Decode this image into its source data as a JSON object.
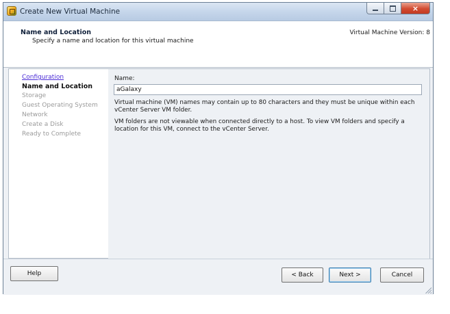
{
  "window": {
    "title": "Create New Virtual Machine",
    "icon": "vsphere-vm-icon",
    "controls": {
      "minimize": "minimize-icon",
      "maximize": "maximize-icon",
      "close": "×"
    }
  },
  "header": {
    "title": "Name and Location",
    "subtitle": "Specify a name and location for this virtual machine",
    "version": "Virtual Machine Version: 8"
  },
  "sidebar": {
    "items": [
      {
        "label": "Configuration",
        "state": "link"
      },
      {
        "label": "Name and Location",
        "state": "current"
      },
      {
        "label": "Storage",
        "state": "disabled"
      },
      {
        "label": "Guest Operating System",
        "state": "disabled"
      },
      {
        "label": "Network",
        "state": "disabled"
      },
      {
        "label": "Create a Disk",
        "state": "disabled"
      },
      {
        "label": "Ready to Complete",
        "state": "disabled"
      }
    ]
  },
  "main": {
    "name_label": "Name:",
    "name_value": "aGalaxy",
    "info1": "Virtual machine (VM) names may contain up to 80 characters and they must be unique within each vCenter Server VM folder.",
    "info2": "VM folders are not viewable when connected directly to a host. To view VM folders and specify a location for this VM, connect to the vCenter Server."
  },
  "footer": {
    "help_label": "Help",
    "back_label": "< Back",
    "next_label": "Next >",
    "cancel_label": "Cancel"
  },
  "colors": {
    "title_bar": "#c4d5ea",
    "close_button": "#d24b31",
    "link": "#4a2bd6",
    "disabled_text": "#9a9a9a"
  }
}
